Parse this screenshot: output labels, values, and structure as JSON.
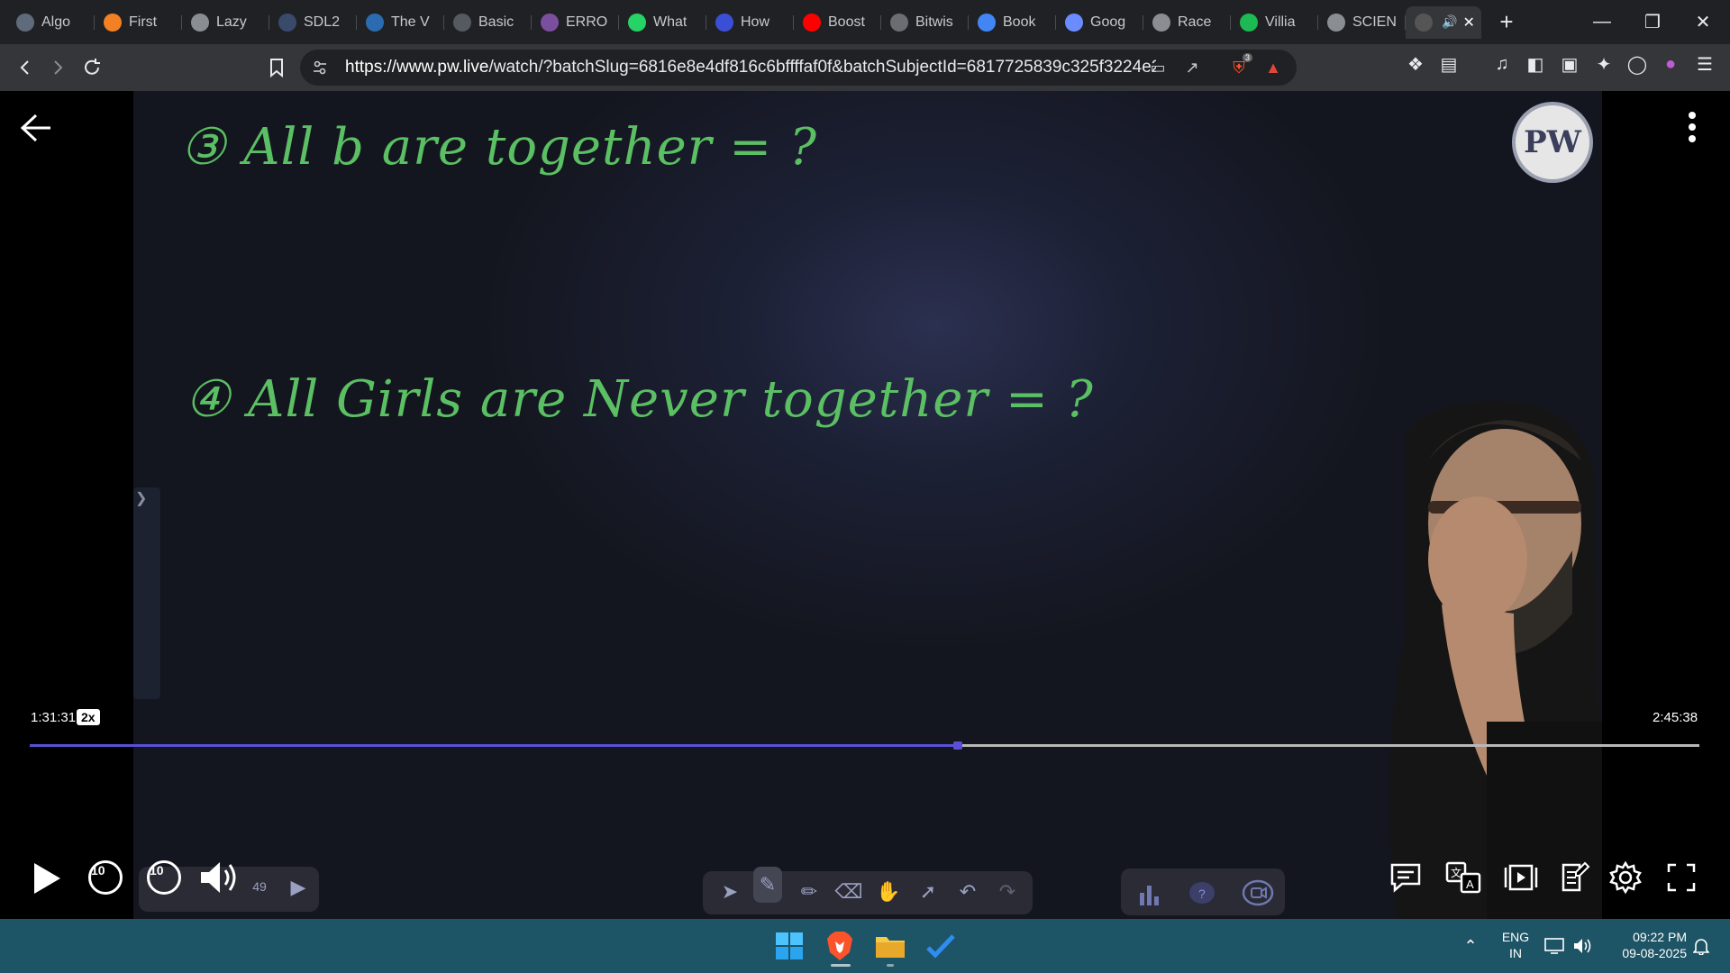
{
  "browser": {
    "tabs": [
      {
        "label": "Algo",
        "icon": "algo-icon",
        "color": "#5f6b7a"
      },
      {
        "label": "First",
        "icon": "stackoverflow-icon",
        "color": "#f48024"
      },
      {
        "label": "Lazy",
        "icon": "globe-icon",
        "color": "#8a8d91"
      },
      {
        "label": "SDL2",
        "icon": "sdl-icon",
        "color": "#3a4a6b"
      },
      {
        "label": "The V",
        "icon": "w3schools-icon",
        "color": "#2b6cb0"
      },
      {
        "label": "Basic",
        "icon": "brackets-icon",
        "color": "#555a60"
      },
      {
        "label": "ERRO",
        "icon": "error-site-icon",
        "color": "#7b4fa0"
      },
      {
        "label": "What",
        "icon": "whatsapp-icon",
        "color": "#25d366"
      },
      {
        "label": "How",
        "icon": "bookmark-site-icon",
        "color": "#3b4fd6"
      },
      {
        "label": "Boost",
        "icon": "youtube-icon",
        "color": "#ff0000"
      },
      {
        "label": "Bitwis",
        "icon": "site-icon",
        "color": "#6a6d72"
      },
      {
        "label": "Book",
        "icon": "google-icon",
        "color": "#4285f4"
      },
      {
        "label": "Goog",
        "icon": "gemini-icon",
        "color": "#6a8cff"
      },
      {
        "label": "Race",
        "icon": "openai-icon",
        "color": "#8a8d91"
      },
      {
        "label": "Villia",
        "icon": "spotify-icon",
        "color": "#1db954"
      },
      {
        "label": "SCIEN",
        "icon": "globe-icon",
        "color": "#8a8d91"
      }
    ],
    "active_tab": {
      "label": "",
      "icon": "pw-favicon-icon",
      "audio": "speaker-icon"
    },
    "url_domain": "https://www.pw.live",
    "url_path": "/watch/?batchSlug=6816e8e4df816c6bffffaf0f&batchSubjectId=6817725839c325f3224e28d...",
    "brave_badge": "3"
  },
  "video": {
    "board_line_1": "③ All b are together = ?",
    "board_line_2": "④ All Girls are Never together = ?",
    "logo_text": "PW",
    "current_time": "1:31:31",
    "speed": "2x",
    "total_time": "2:45:38",
    "progress_fraction": 0.553,
    "rewind_label": "10",
    "forward_label": "10",
    "badge_count": "49"
  },
  "taskbar": {
    "lang_top": "ENG",
    "lang_bottom": "IN",
    "time": "09:22 PM",
    "date": "09-08-2025"
  },
  "colors": {
    "accent": "#5a4fd6",
    "chalk": "#5bbf63",
    "taskbar": "#1d5466"
  }
}
